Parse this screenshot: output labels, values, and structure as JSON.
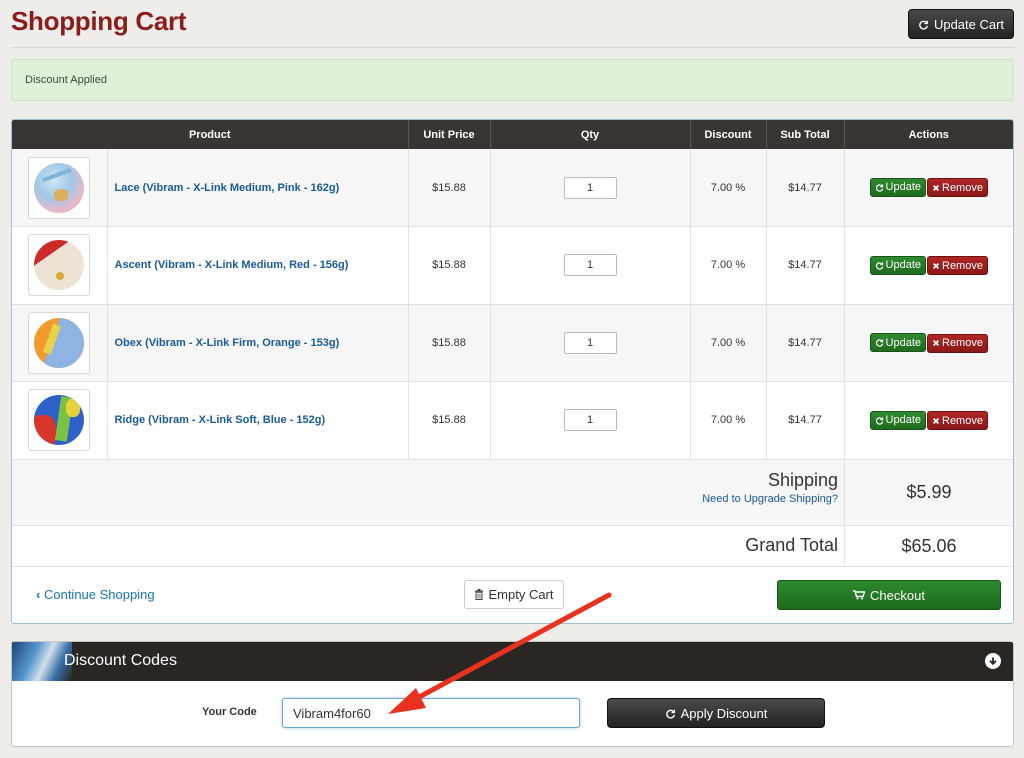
{
  "header": {
    "title": "Shopping Cart",
    "update_cart_label": "Update Cart"
  },
  "alert": {
    "message": "Discount Applied"
  },
  "table": {
    "columns": [
      "Product",
      "Unit Price",
      "Qty",
      "Discount",
      "Sub Total",
      "Actions"
    ],
    "update_label": "Update",
    "remove_label": "Remove",
    "items": [
      {
        "name": "Lace (Vibram - X-Link Medium, Pink - 162g)",
        "unit_price": "$15.88",
        "qty": "1",
        "discount": "7.00 %",
        "subtotal": "$14.77",
        "disc_color": "pink"
      },
      {
        "name": "Ascent (Vibram - X-Link Medium, Red - 156g)",
        "unit_price": "$15.88",
        "qty": "1",
        "discount": "7.00 %",
        "subtotal": "$14.77",
        "disc_color": "red"
      },
      {
        "name": "Obex (Vibram - X-Link Firm, Orange - 153g)",
        "unit_price": "$15.88",
        "qty": "1",
        "discount": "7.00 %",
        "subtotal": "$14.77",
        "disc_color": "orange"
      },
      {
        "name": "Ridge (Vibram - X-Link Soft, Blue - 152g)",
        "unit_price": "$15.88",
        "qty": "1",
        "discount": "7.00 %",
        "subtotal": "$14.77",
        "disc_color": "blue"
      }
    ]
  },
  "totals": {
    "shipping_label": "Shipping",
    "shipping_upgrade_link": "Need to Upgrade Shipping?",
    "shipping_value": "$5.99",
    "grand_total_label": "Grand Total",
    "grand_total_value": "$65.06"
  },
  "footer_actions": {
    "continue_label": "Continue Shopping",
    "empty_cart_label": "Empty Cart",
    "checkout_label": "Checkout"
  },
  "discount": {
    "title": "Discount Codes",
    "code_label": "Your Code",
    "code_value": "Vibram4for60",
    "apply_label": "Apply Discount"
  },
  "colors": {
    "title": "#8b1c1c",
    "header_bg": "#3a3532",
    "link": "#1a5a9a",
    "update_green": "#2f8a2f",
    "remove_red": "#b02626",
    "annotation_arrow": "#e8321e"
  },
  "icons": {
    "update_cart": "refresh-icon",
    "update": "refresh-icon",
    "remove": "close-icon",
    "continue": "chevron-left-icon",
    "empty_cart": "trash-icon",
    "checkout": "cart-icon",
    "discount_toggle": "arrow-down-circle-icon",
    "apply": "refresh-icon"
  }
}
